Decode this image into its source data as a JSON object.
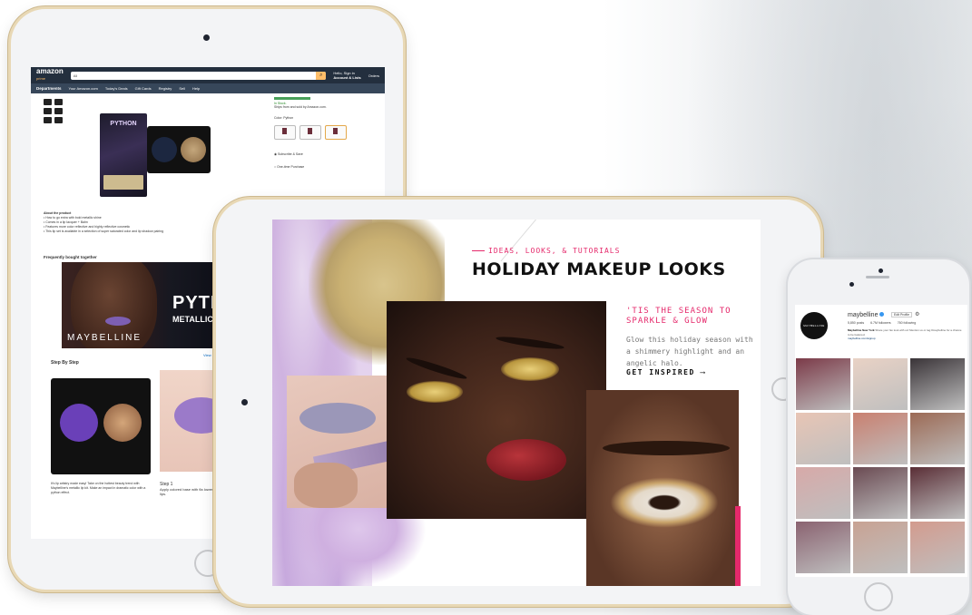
{
  "amazon": {
    "logo": "amazon",
    "logo_sub": "prime",
    "search_placeholder": "All",
    "account_line1": "Hello, Sign in",
    "account_line2": "Account & Lists",
    "orders": "Orders",
    "nav": {
      "departments": "Departments",
      "links": [
        "Your Amazon.com",
        "Today's Deals",
        "Gift Cards",
        "Registry",
        "Sell",
        "Help"
      ]
    },
    "right": {
      "stock": "In Stock.",
      "sold_by": "Ships from and sold by Amazon.com.",
      "color_label": "Color: Python",
      "subscribe": "Subscribe & Save",
      "one_time": "One-time Purchase"
    },
    "box_title": "PYTHON",
    "about_title": "About the product",
    "about_items": [
      "How to go extra with bold metallic shine",
      "Comes in a lip lacquer + Balm",
      "Features more color reflective and highly reflective cosmetic",
      "This lip set is available in a selection of super saturated color and lip shadow pairing"
    ],
    "frequently_bought": "Frequently bought together",
    "banner_brand": "MAYBELLINE",
    "banner_title": "PYTHO",
    "banner_sub": "METALLIC LI",
    "banner_view": "View",
    "step_title": "Step By Step",
    "step1_caption": "It's lip artistry made easy! Take on the hottest beauty trend with Maybelline's metallic lip kit. Make an impact in dramatic color with a python effect.",
    "step1_title": "Step 1",
    "step1_text": "Apply colored base with fla lower lips."
  },
  "holiday": {
    "eyebrow": "IDEAS, LOOKS, & TUTORIALS",
    "title": "HOLIDAY MAKEUP LOOKS",
    "tagline": "'TIS THE SEASON TO SPARKLE & GLOW",
    "copy": "Glow this holiday season with a shimmery highlight and an angelic halo.",
    "cta": "GET INSPIRED",
    "accent": "#e5296b"
  },
  "instagram": {
    "username": "maybelline",
    "edit_profile": "Edit Profile",
    "avatar_text": "MAYBELLINE",
    "stats": [
      "5,850 posts",
      "6.7M followers",
      "760 following"
    ],
    "bio_name": "Maybelline New York",
    "bio_text": "Share your fav look with us! Mention us or tag #maybelline for a chance to be featured.",
    "bio_link": "maybelline.com/signup",
    "grid_colors": [
      "#7b3a48",
      "#e9d2c5",
      "#3a3438",
      "#e8c5b5",
      "#c98070",
      "#9c6a55",
      "#d7a9a8",
      "#6a4a52",
      "#5a2e36",
      "#8a6270",
      "#c8a293",
      "#d39b8e"
    ]
  }
}
